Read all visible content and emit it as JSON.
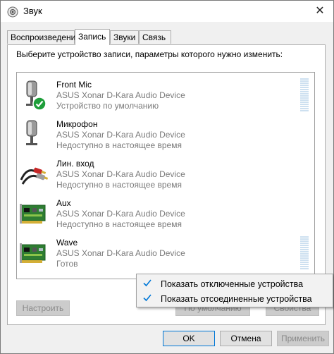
{
  "window": {
    "title": "Звук",
    "close_glyph": "✕"
  },
  "tabs": [
    {
      "label": "Воспроизведение",
      "active": false
    },
    {
      "label": "Запись",
      "active": true
    },
    {
      "label": "Звуки",
      "active": false
    },
    {
      "label": "Связь",
      "active": false
    }
  ],
  "panel": {
    "instruction": "Выберите устройство записи, параметры которого нужно изменить:"
  },
  "devices": [
    {
      "name": "Front Mic",
      "device": "ASUS Xonar D-Kara Audio Device",
      "status": "Устройство по умолчанию",
      "icon": "microphone-icon",
      "default": true
    },
    {
      "name": "Микрофон",
      "device": "ASUS Xonar D-Kara Audio Device",
      "status": "Недоступно в настоящее время",
      "icon": "microphone-icon",
      "default": false
    },
    {
      "name": "Лин. вход",
      "device": "ASUS Xonar D-Kara Audio Device",
      "status": "Недоступно в настоящее время",
      "icon": "rca-cable-icon",
      "default": false
    },
    {
      "name": "Aux",
      "device": "ASUS Xonar D-Kara Audio Device",
      "status": "Недоступно в настоящее время",
      "icon": "sound-card-icon",
      "default": false
    },
    {
      "name": "Wave",
      "device": "ASUS Xonar D-Kara Audio Device",
      "status": "Готов",
      "icon": "sound-card-icon",
      "default": false
    }
  ],
  "buttons": {
    "configure": "Настроить",
    "default": "По умолчанию",
    "properties": "Свойства",
    "ok": "OK",
    "cancel": "Отмена",
    "apply": "Применить"
  },
  "context_menu": {
    "items": [
      {
        "label": "Показать отключенные устройства",
        "checked": true
      },
      {
        "label": "Показать отсоединенные устройства",
        "checked": true
      }
    ]
  },
  "colors": {
    "accent": "#0078d7",
    "check_green": "#1e9e3a",
    "meter": "#cde0f0"
  }
}
